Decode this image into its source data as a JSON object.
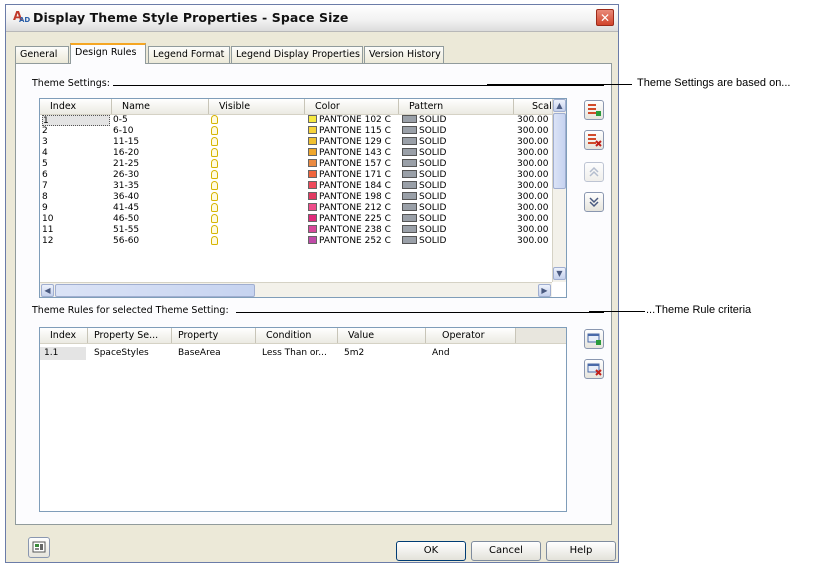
{
  "window": {
    "title": "Display Theme Style Properties - Space Size",
    "app_icon_text": "A",
    "app_icon_sub": "AD",
    "close_glyph": "✕"
  },
  "tabs": [
    {
      "label": "General"
    },
    {
      "label": "Design Rules"
    },
    {
      "label": "Legend Format"
    },
    {
      "label": "Legend Display Properties"
    },
    {
      "label": "Version History"
    }
  ],
  "theme_settings": {
    "label": "Theme Settings:",
    "columns": [
      "Index",
      "Name",
      "Visible",
      "Color",
      "Pattern",
      "Scale"
    ],
    "rows": [
      {
        "index": "1",
        "name": "0-5",
        "color": "PANTONE 102 C",
        "color_hex": "#f6e840",
        "pattern": "SOLID",
        "scale": "300.00"
      },
      {
        "index": "2",
        "name": "6-10",
        "color": "PANTONE 115 C",
        "color_hex": "#f6d23a",
        "pattern": "SOLID",
        "scale": "300.00"
      },
      {
        "index": "3",
        "name": "11-15",
        "color": "PANTONE 129 C",
        "color_hex": "#f0c030",
        "pattern": "SOLID",
        "scale": "300.00"
      },
      {
        "index": "4",
        "name": "16-20",
        "color": "PANTONE 143 C",
        "color_hex": "#efa62c",
        "pattern": "SOLID",
        "scale": "300.00"
      },
      {
        "index": "5",
        "name": "21-25",
        "color": "PANTONE 157 C",
        "color_hex": "#ea8a42",
        "pattern": "SOLID",
        "scale": "300.00"
      },
      {
        "index": "6",
        "name": "26-30",
        "color": "PANTONE 171 C",
        "color_hex": "#f0643c",
        "pattern": "SOLID",
        "scale": "300.00"
      },
      {
        "index": "7",
        "name": "31-35",
        "color": "PANTONE 184 C",
        "color_hex": "#ef4a5c",
        "pattern": "SOLID",
        "scale": "300.00"
      },
      {
        "index": "8",
        "name": "36-40",
        "color": "PANTONE 198 C",
        "color_hex": "#e23a62",
        "pattern": "SOLID",
        "scale": "300.00"
      },
      {
        "index": "9",
        "name": "41-45",
        "color": "PANTONE 212 C",
        "color_hex": "#ef4c8a",
        "pattern": "SOLID",
        "scale": "300.00"
      },
      {
        "index": "10",
        "name": "46-50",
        "color": "PANTONE 225 C",
        "color_hex": "#e02a7a",
        "pattern": "SOLID",
        "scale": "300.00"
      },
      {
        "index": "11",
        "name": "51-55",
        "color": "PANTONE 238 C",
        "color_hex": "#d8489a",
        "pattern": "SOLID",
        "scale": "300.00"
      },
      {
        "index": "12",
        "name": "56-60",
        "color": "PANTONE 252 C",
        "color_hex": "#c04aa8",
        "pattern": "SOLID",
        "scale": "300.00"
      }
    ]
  },
  "theme_rules": {
    "label": "Theme Rules for selected Theme Setting:",
    "columns": [
      "Index",
      "Property Se...",
      "Property",
      "Condition",
      "Value",
      "Operator"
    ],
    "rows": [
      {
        "index": "1.1",
        "property_set": "SpaceStyles",
        "property": "BaseArea",
        "condition": "Less Than or...",
        "value": "5m2",
        "operator": "And"
      }
    ]
  },
  "buttons": {
    "ok": "OK",
    "cancel": "Cancel",
    "help": "Help"
  },
  "callouts": {
    "settings": "Theme Settings are based on...",
    "rules": "...Theme Rule criteria"
  },
  "icons": {
    "add_setting": "add-theme-setting-icon",
    "remove_setting": "remove-theme-setting-icon",
    "move_up": "move-up-icon",
    "move_down": "move-down-icon",
    "add_rule": "add-theme-rule-icon",
    "remove_rule": "remove-theme-rule-icon",
    "style_browser": "style-browser-icon"
  }
}
